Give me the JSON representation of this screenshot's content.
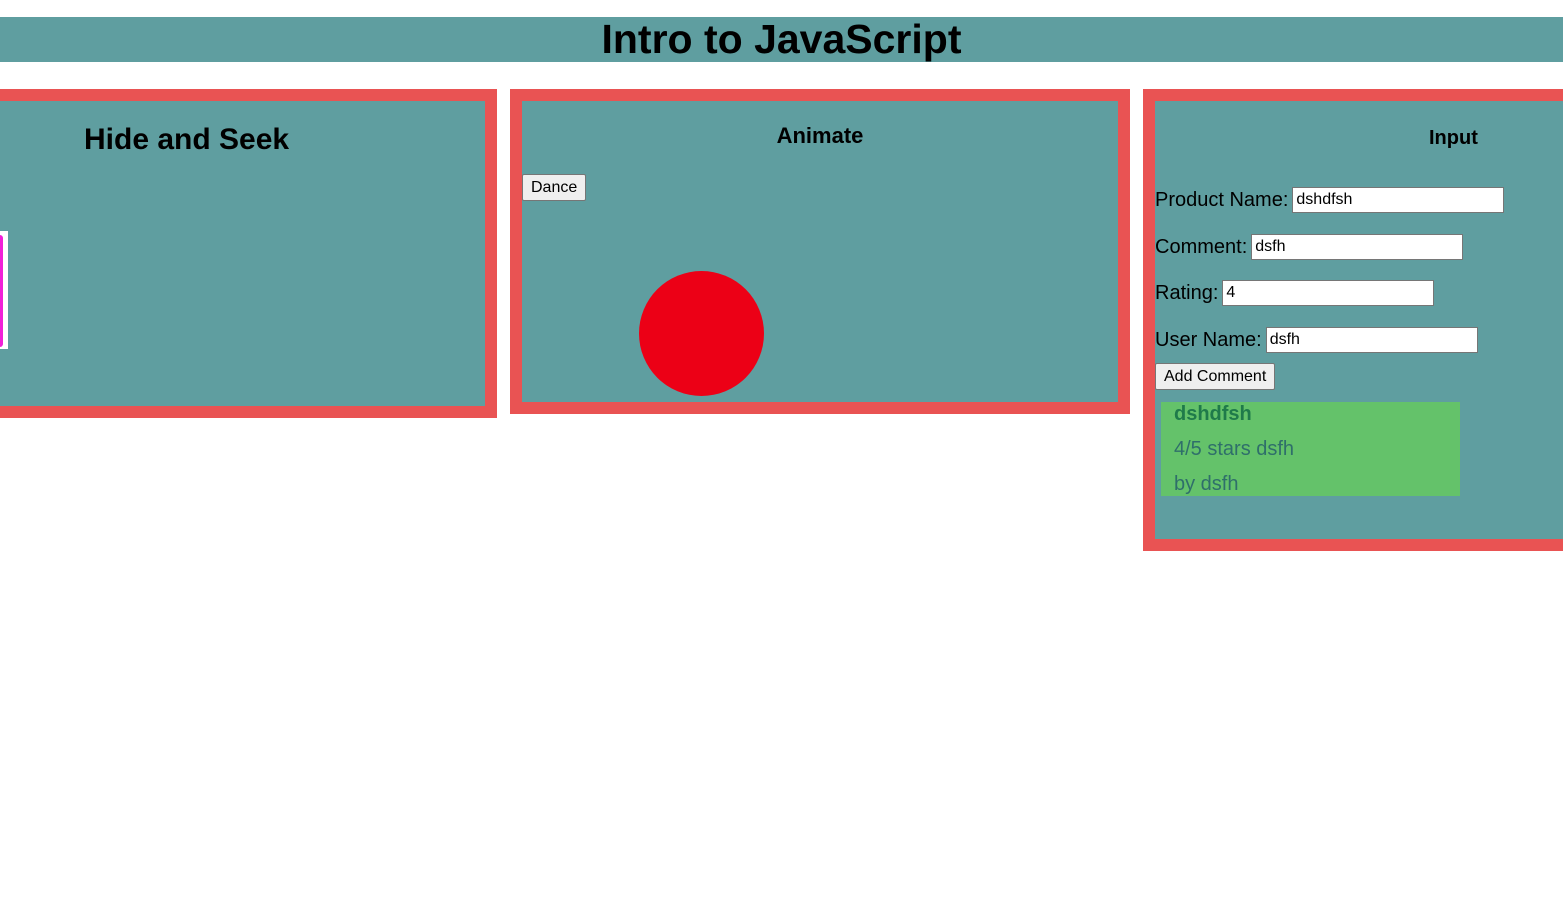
{
  "page": {
    "title": "Intro to JavaScript"
  },
  "colors": {
    "header_bg": "#5f9ea0",
    "panel_bg": "#5f9ea0",
    "panel_border": "#e95353",
    "ball": "#ec0016",
    "comment_card_bg": "#64c26a"
  },
  "hide_and_seek": {
    "title": "Hide and Seek"
  },
  "animate": {
    "title": "Animate",
    "dance_label": "Dance"
  },
  "input": {
    "title": "Input",
    "fields": {
      "product_name": {
        "label": "Product Name:",
        "value": "dshdfsh"
      },
      "comment": {
        "label": "Comment:",
        "value": "dsfh"
      },
      "rating": {
        "label": "Rating:",
        "value": "4"
      },
      "user_name": {
        "label": "User Name:",
        "value": "dsfh"
      }
    },
    "add_comment_label": "Add Comment",
    "comments": [
      {
        "product": "dshdfsh",
        "rating_line": "4/5 stars dsfh",
        "by_line": "by dsfh"
      }
    ]
  }
}
